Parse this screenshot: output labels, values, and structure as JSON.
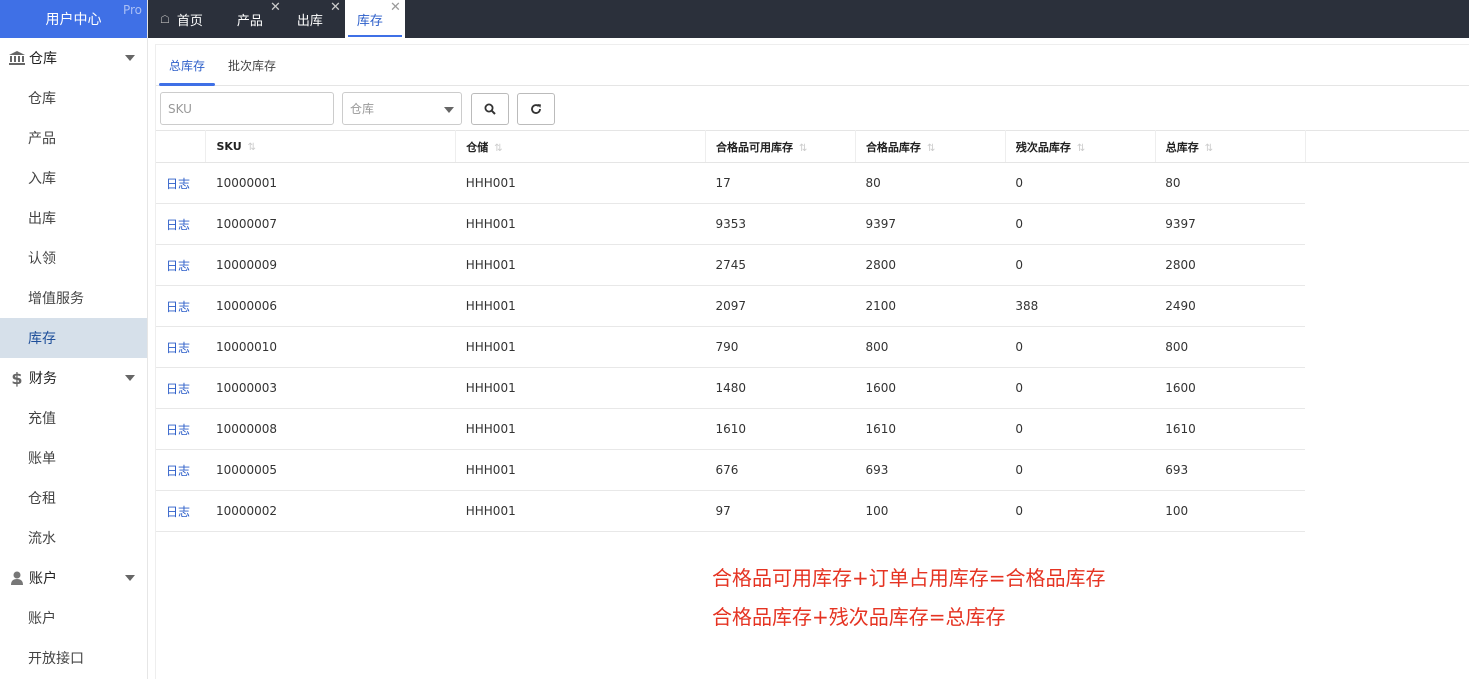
{
  "brand": {
    "title": "用户中心",
    "badge": "Pro"
  },
  "sidebar": {
    "groups": [
      {
        "label": "仓库",
        "icon": "bank-icon",
        "items": [
          "仓库",
          "产品",
          "入库",
          "出库",
          "认领",
          "增值服务",
          "库存"
        ],
        "active": "库存"
      },
      {
        "label": "财务",
        "icon": "dollar-icon",
        "items": [
          "充值",
          "账单",
          "仓租",
          "流水"
        ]
      },
      {
        "label": "账户",
        "icon": "user-icon",
        "items": [
          "账户",
          "开放接口"
        ]
      }
    ]
  },
  "tabs": [
    {
      "label": "首页",
      "closable": false
    },
    {
      "label": "产品",
      "closable": true
    },
    {
      "label": "出库",
      "closable": true
    },
    {
      "label": "库存",
      "closable": true,
      "active": true
    }
  ],
  "subtabs": [
    "总库存",
    "批次库存"
  ],
  "filters": {
    "sku_placeholder": "SKU",
    "warehouse_placeholder": "仓库"
  },
  "table": {
    "columns": [
      "",
      "SKU",
      "仓储",
      "合格品可用库存",
      "合格品库存",
      "残次品库存",
      "总库存"
    ],
    "action_label": "日志",
    "rows": [
      [
        "10000001",
        "HHH001",
        "17",
        "80",
        "0",
        "80"
      ],
      [
        "10000007",
        "HHH001",
        "9353",
        "9397",
        "0",
        "9397"
      ],
      [
        "10000009",
        "HHH001",
        "2745",
        "2800",
        "0",
        "2800"
      ],
      [
        "10000006",
        "HHH001",
        "2097",
        "2100",
        "388",
        "2490"
      ],
      [
        "10000010",
        "HHH001",
        "790",
        "800",
        "0",
        "800"
      ],
      [
        "10000003",
        "HHH001",
        "1480",
        "1600",
        "0",
        "1600"
      ],
      [
        "10000008",
        "HHH001",
        "1610",
        "1610",
        "0",
        "1610"
      ],
      [
        "10000005",
        "HHH001",
        "676",
        "693",
        "0",
        "693"
      ],
      [
        "10000002",
        "HHH001",
        "97",
        "100",
        "0",
        "100"
      ]
    ]
  },
  "notes": [
    "合格品可用库存+订单占用库存=合格品库存",
    "合格品库存+残次品库存=总库存"
  ],
  "colors": {
    "accent": "#3f70e6",
    "note": "#e53322",
    "topbar": "#2b303b"
  }
}
